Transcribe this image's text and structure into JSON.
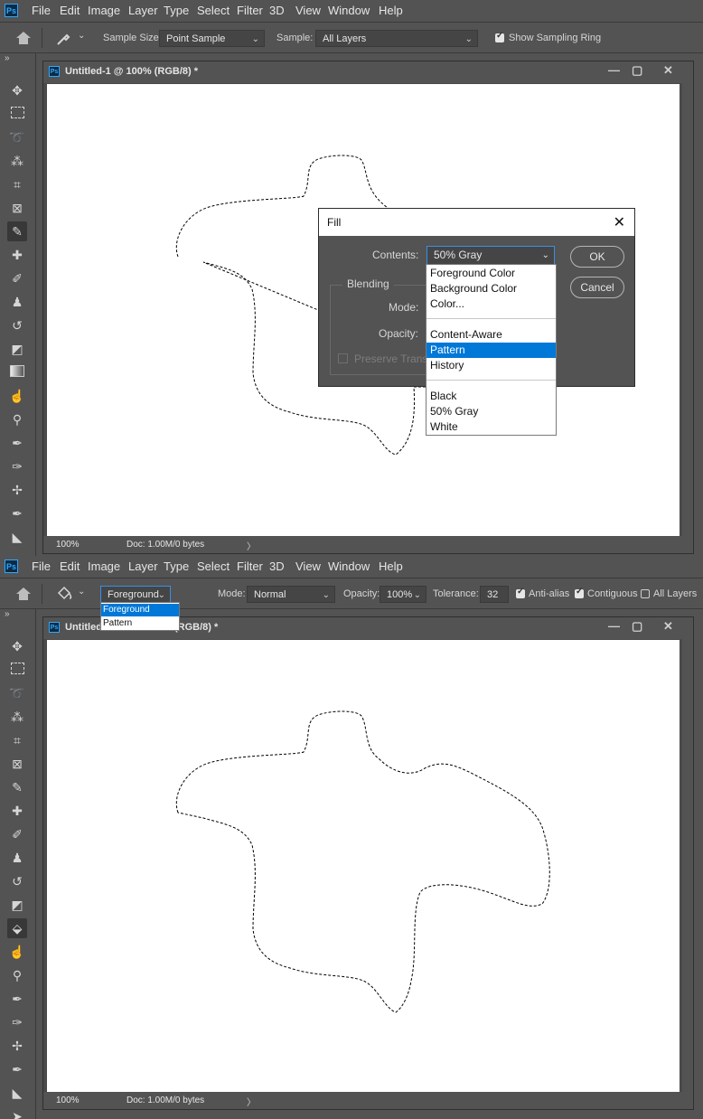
{
  "menu": [
    "File",
    "Edit",
    "Image",
    "Layer",
    "Type",
    "Select",
    "Filter",
    "3D",
    "View",
    "Window",
    "Help"
  ],
  "logo": "Ps",
  "pane1": {
    "options": {
      "sample_size_label": "Sample Size:",
      "sample_size_value": "Point Sample",
      "sample_label": "Sample:",
      "sample_value": "All Layers",
      "show_ring_label": "Show Sampling Ring"
    },
    "doc": {
      "title": "Untitled-1 @ 100% (RGB/8) *",
      "zoom": "100%",
      "docinfo": "Doc: 1.00M/0 bytes"
    },
    "fill_dialog": {
      "title": "Fill",
      "contents_label": "Contents:",
      "contents_value": "50% Gray",
      "blending_label": "Blending",
      "mode_label": "Mode:",
      "opacity_label": "Opacity:",
      "preserve_label": "Preserve Trans",
      "ok_label": "OK",
      "cancel_label": "Cancel",
      "options": [
        {
          "label": "Foreground Color"
        },
        {
          "label": "Background Color"
        },
        {
          "label": "Color..."
        },
        {
          "label": "Content-Aware"
        },
        {
          "label": "Pattern",
          "selected": true
        },
        {
          "label": "History"
        },
        {
          "label": "Black"
        },
        {
          "label": "50% Gray"
        },
        {
          "label": "White"
        }
      ]
    }
  },
  "pane2": {
    "options": {
      "fill_source_value": "Foreground",
      "fill_source_options": [
        {
          "label": "Foreground",
          "selected": true
        },
        {
          "label": "Pattern"
        }
      ],
      "mode_label": "Mode:",
      "mode_value": "Normal",
      "opacity_label": "Opacity:",
      "opacity_value": "100%",
      "tolerance_label": "Tolerance:",
      "tolerance_value": "32",
      "antialias_label": "Anti-alias",
      "contiguous_label": "Contiguous",
      "alllayers_label": "All Layers"
    },
    "doc": {
      "title_visible_left": "Untitled-1",
      "title_visible_right": "(RGB/8) *",
      "zoom": "100%",
      "docinfo": "Doc: 1.00M/0 bytes"
    }
  },
  "colors": {
    "ui_bg": "#535353",
    "dark": "#383838",
    "accent": "#0078d7",
    "ps_blue": "#31a8ff"
  }
}
